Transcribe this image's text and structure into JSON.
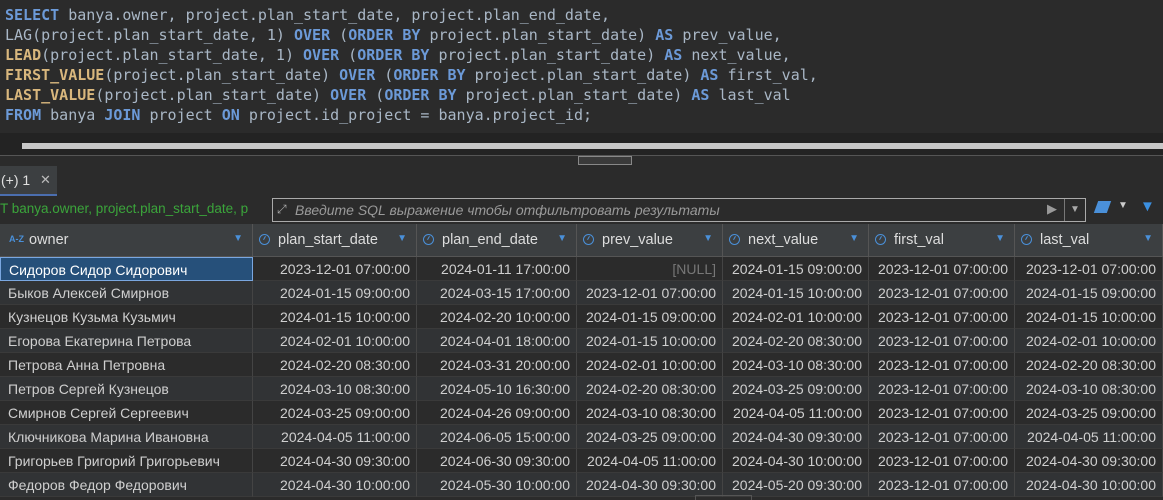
{
  "sql": {
    "line1": {
      "k1": "SELECT",
      "t1": " banya.owner, project.plan_start_date, project.plan_end_date,"
    },
    "line2": {
      "f": "LAG",
      "t1": "(project.plan_start_date, 1) ",
      "k1": "OVER",
      "t2": " (",
      "k2": "ORDER BY",
      "t3": " project.plan_start_date) ",
      "k3": "AS",
      "t4": " prev_value,"
    },
    "line3": {
      "f": "LEAD",
      "t1": "(project.plan_start_date, 1) ",
      "k1": "OVER",
      "t2": " (",
      "k2": "ORDER BY",
      "t3": " project.plan_start_date) ",
      "k3": "AS",
      "t4": " next_value,"
    },
    "line4": {
      "f": "FIRST_VALUE",
      "t1": "(project.plan_start_date) ",
      "k1": "OVER",
      "t2": " (",
      "k2": "ORDER BY",
      "t3": " project.plan_start_date) ",
      "k3": "AS",
      "t4": " first_val,"
    },
    "line5": {
      "f": "LAST_VALUE",
      "t1": "(project.plan_start_date) ",
      "k1": "OVER",
      "t2": " (",
      "k2": "ORDER BY",
      "t3": " project.plan_start_date) ",
      "k3": "AS",
      "t4": " last_val"
    },
    "line6": {
      "k1": "FROM",
      "t1": " banya ",
      "k2": "JOIN",
      "t2": " project ",
      "k3": "ON",
      "t3": " project.id_project = banya.project_id;"
    }
  },
  "tab": {
    "label": "(+) 1",
    "close": "✕"
  },
  "filter": {
    "prefix": "T banya.owner, project.plan_start_date, p",
    "placeholder": "Введите SQL выражение чтобы отфильтровать результаты",
    "play": "▶",
    "drop": "▼"
  },
  "toolbar": {
    "eraser_drop": "▼",
    "funnel": "▼"
  },
  "colors": {
    "accent": "#4a90d9",
    "keyword": "#6c9ad8",
    "function": "#d9b77d",
    "filter_prefix": "#3ba53b"
  },
  "table": {
    "az": "A-Z",
    "sort_glyph": "▼",
    "columns": [
      "owner",
      "plan_start_date",
      "plan_end_date",
      "prev_value",
      "next_value",
      "first_val",
      "last_val"
    ],
    "rows": [
      [
        "Сидоров Сидор Сидорович",
        "2023-12-01 07:00:00",
        "2024-01-11 17:00:00",
        "[NULL]",
        "2024-01-15 09:00:00",
        "2023-12-01 07:00:00",
        "2023-12-01 07:00:00"
      ],
      [
        "Быков Алексей Смирнов",
        "2024-01-15 09:00:00",
        "2024-03-15 17:00:00",
        "2023-12-01 07:00:00",
        "2024-01-15 10:00:00",
        "2023-12-01 07:00:00",
        "2024-01-15 09:00:00"
      ],
      [
        "Кузнецов Кузьма Кузьмич",
        "2024-01-15 10:00:00",
        "2024-02-20 10:00:00",
        "2024-01-15 09:00:00",
        "2024-02-01 10:00:00",
        "2023-12-01 07:00:00",
        "2024-01-15 10:00:00"
      ],
      [
        "Егорова Екатерина Петрова",
        "2024-02-01 10:00:00",
        "2024-04-01 18:00:00",
        "2024-01-15 10:00:00",
        "2024-02-20 08:30:00",
        "2023-12-01 07:00:00",
        "2024-02-01 10:00:00"
      ],
      [
        "Петрова Анна Петровна",
        "2024-02-20 08:30:00",
        "2024-03-31 20:00:00",
        "2024-02-01 10:00:00",
        "2024-03-10 08:30:00",
        "2023-12-01 07:00:00",
        "2024-02-20 08:30:00"
      ],
      [
        "Петров Сергей Кузнецов",
        "2024-03-10 08:30:00",
        "2024-05-10 16:30:00",
        "2024-02-20 08:30:00",
        "2024-03-25 09:00:00",
        "2023-12-01 07:00:00",
        "2024-03-10 08:30:00"
      ],
      [
        "Смирнов Сергей Сергеевич",
        "2024-03-25 09:00:00",
        "2024-04-26 09:00:00",
        "2024-03-10 08:30:00",
        "2024-04-05 11:00:00",
        "2023-12-01 07:00:00",
        "2024-03-25 09:00:00"
      ],
      [
        "Ключникова Марина Ивановна",
        "2024-04-05 11:00:00",
        "2024-06-05 15:00:00",
        "2024-03-25 09:00:00",
        "2024-04-30 09:30:00",
        "2023-12-01 07:00:00",
        "2024-04-05 11:00:00"
      ],
      [
        "Григорьев Григорий Григорьевич",
        "2024-04-30 09:30:00",
        "2024-06-30 09:30:00",
        "2024-04-05 11:00:00",
        "2024-04-30 10:00:00",
        "2023-12-01 07:00:00",
        "2024-04-30 09:30:00"
      ],
      [
        "Федоров Федор Федорович",
        "2024-04-30 10:00:00",
        "2024-05-30 10:00:00",
        "2024-04-30 09:30:00",
        "2024-05-20 09:30:00",
        "2023-12-01 07:00:00",
        "2024-04-30 10:00:00"
      ]
    ]
  }
}
